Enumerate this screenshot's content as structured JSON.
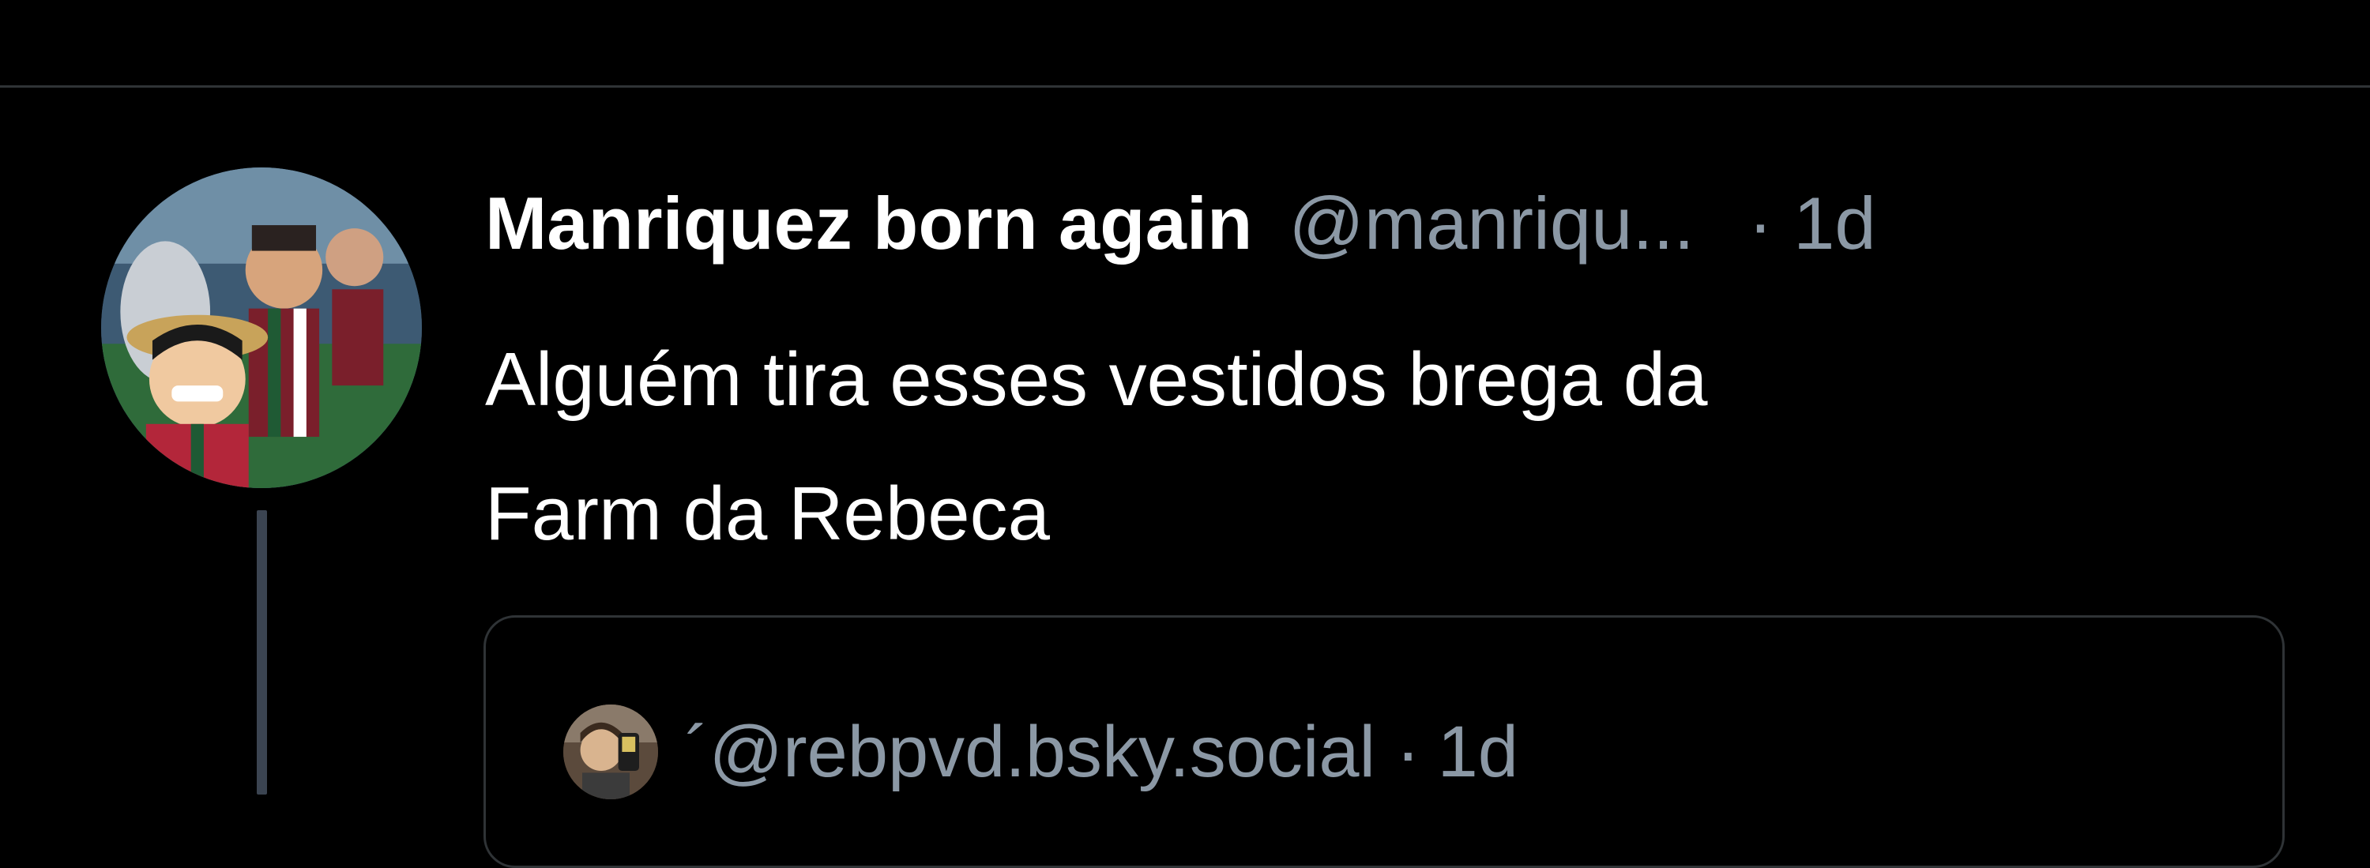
{
  "tweet": {
    "author": {
      "display_name": "Manriquez born again",
      "handle": "@manriqu...",
      "avatar_icon": "user-avatar-photo"
    },
    "separator": "·",
    "timestamp": "1d",
    "text_line1": "Alguém tira esses vestidos brega da",
    "text_line2": "Farm da Rebeca",
    "quoted_post": {
      "handle": "´@rebpvd.bsky.social",
      "separator": "·",
      "timestamp": "1d",
      "avatar_icon": "user-avatar-photo"
    }
  },
  "colors": {
    "background": "#000000",
    "primary_text": "#ffffff",
    "secondary_text": "#8b98a5",
    "divider": "#2f3336",
    "thread_line": "#3b4451"
  }
}
